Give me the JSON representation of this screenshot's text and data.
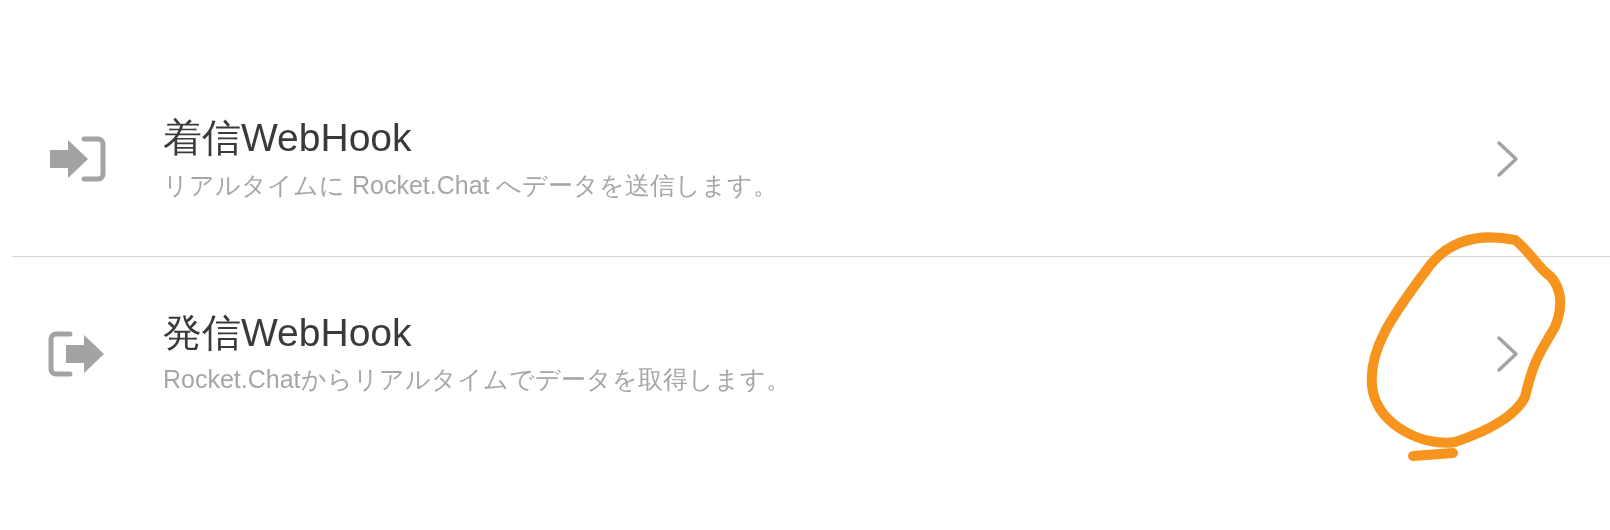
{
  "items": [
    {
      "kind": "incoming",
      "title": "着信WebHook",
      "description": "リアルタイムに Rocket.Chat へデータを送信します。"
    },
    {
      "kind": "outgoing",
      "title": "発信WebHook",
      "description": "Rocket.Chatからリアルタイムでデータを取得します。"
    }
  ]
}
